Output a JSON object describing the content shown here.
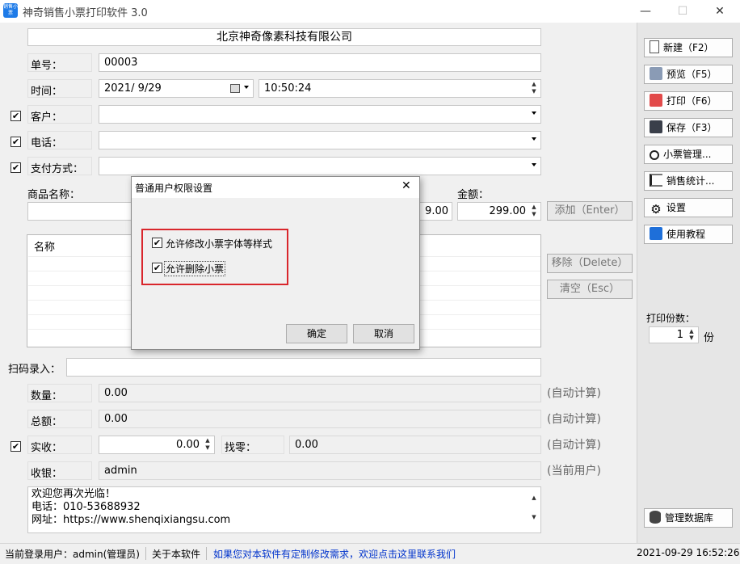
{
  "window": {
    "title": "神奇销售小票打印软件 3.0",
    "icon_text": "销售小票",
    "minimize_glyph": "—",
    "maximize_glyph": "☐",
    "close_glyph": "✕"
  },
  "form": {
    "company_name": "北京神奇像素科技有限公司",
    "order_no_label": "单号：",
    "order_no_value": "00003",
    "time_label": "时间：",
    "date_value": "2021/  9/29",
    "time_value": "10:50:24",
    "customer_label": "客户：",
    "phone_label": "电话：",
    "payment_label": "支付方式：",
    "product_name_label": "商品名称：",
    "amount_label": "金额：",
    "price_partial": "9.00",
    "amount_value": "299.00",
    "add_button": "添加（Enter）",
    "list_header_name": "名称",
    "remove_button": "移除（Delete）",
    "clear_button": "清空（Esc）",
    "scan_label": "扫码录入：",
    "quantity_label": "数量：",
    "quantity_value": "0.00",
    "total_label": "总额：",
    "total_value": "0.00",
    "received_label": "实收：",
    "received_value": "0.00",
    "change_label": "找零：",
    "change_value": "0.00",
    "cashier_label": "收银：",
    "cashier_value": "admin",
    "auto_calc": "(自动计算)",
    "current_user_hint": "(当前用户)",
    "footer_line1": "欢迎您再次光临！",
    "footer_line2": "电话：010-53688932",
    "footer_line3": "网址：https://www.shenqixiangsu.com"
  },
  "sidebar": {
    "new_button": "新建（F2）",
    "preview_button": "预览（F5）",
    "print_button": "打印（F6）",
    "save_button": "保存（F3）",
    "ticket_manage_button": "小票管理...",
    "sales_stats_button": "销售统计...",
    "settings_button": "设置",
    "tutorial_button": "使用教程",
    "print_copies_label": "打印份数：",
    "print_copies_value": "1",
    "copies_unit": "份",
    "db_manage_button": "管理数据库"
  },
  "dialog": {
    "title": "普通用户权限设置",
    "option1": "允许修改小票字体等样式",
    "option1_checked": true,
    "option2": "允许删除小票",
    "option2_checked": true,
    "ok_button": "确定",
    "cancel_button": "取消",
    "highlight_color": "#d9262c"
  },
  "statusbar": {
    "current_user": "当前登录用户：admin(管理员)",
    "about": "关于本软件",
    "custom_link": "如果您对本软件有定制修改需求，欢迎点击这里联系我们",
    "datetime": "2021-09-29 16:52:26"
  },
  "colors": {
    "link": "#0033cc",
    "accent": "#1e7be8"
  }
}
